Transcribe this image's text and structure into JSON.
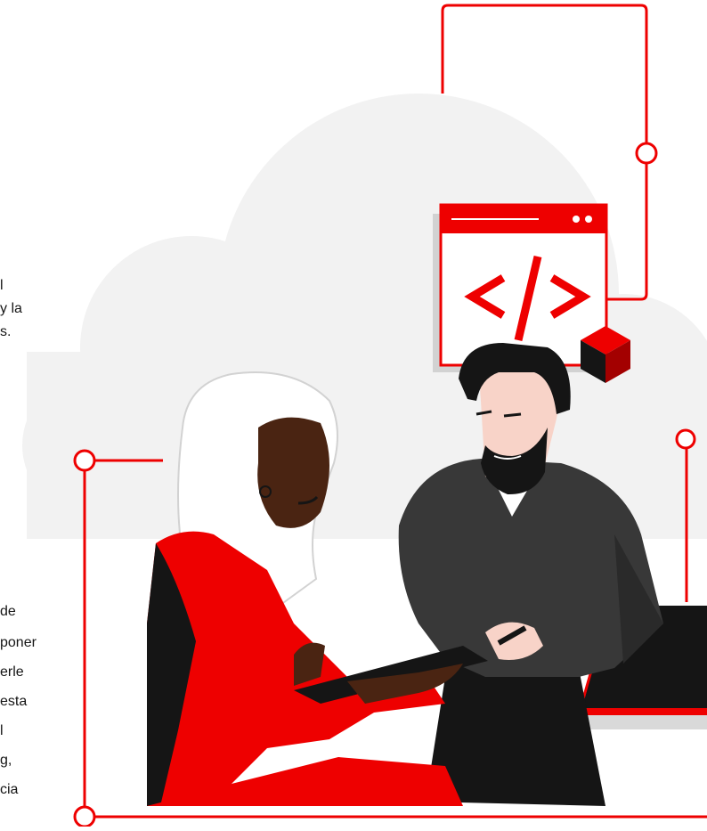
{
  "colors": {
    "accent": "#ee0000",
    "cloud": "#f2f2f2",
    "dark": "#151515"
  },
  "text_fragments": {
    "block1": [
      "l",
      "y la",
      "s."
    ],
    "block2": [
      "de",
      "poner",
      "erle",
      "esta",
      "l",
      "g,",
      "cia"
    ]
  },
  "illustration": {
    "code_window_glyph": "</>",
    "icons": [
      "code-window-icon",
      "cube-icon",
      "tablet",
      "laptop"
    ]
  }
}
